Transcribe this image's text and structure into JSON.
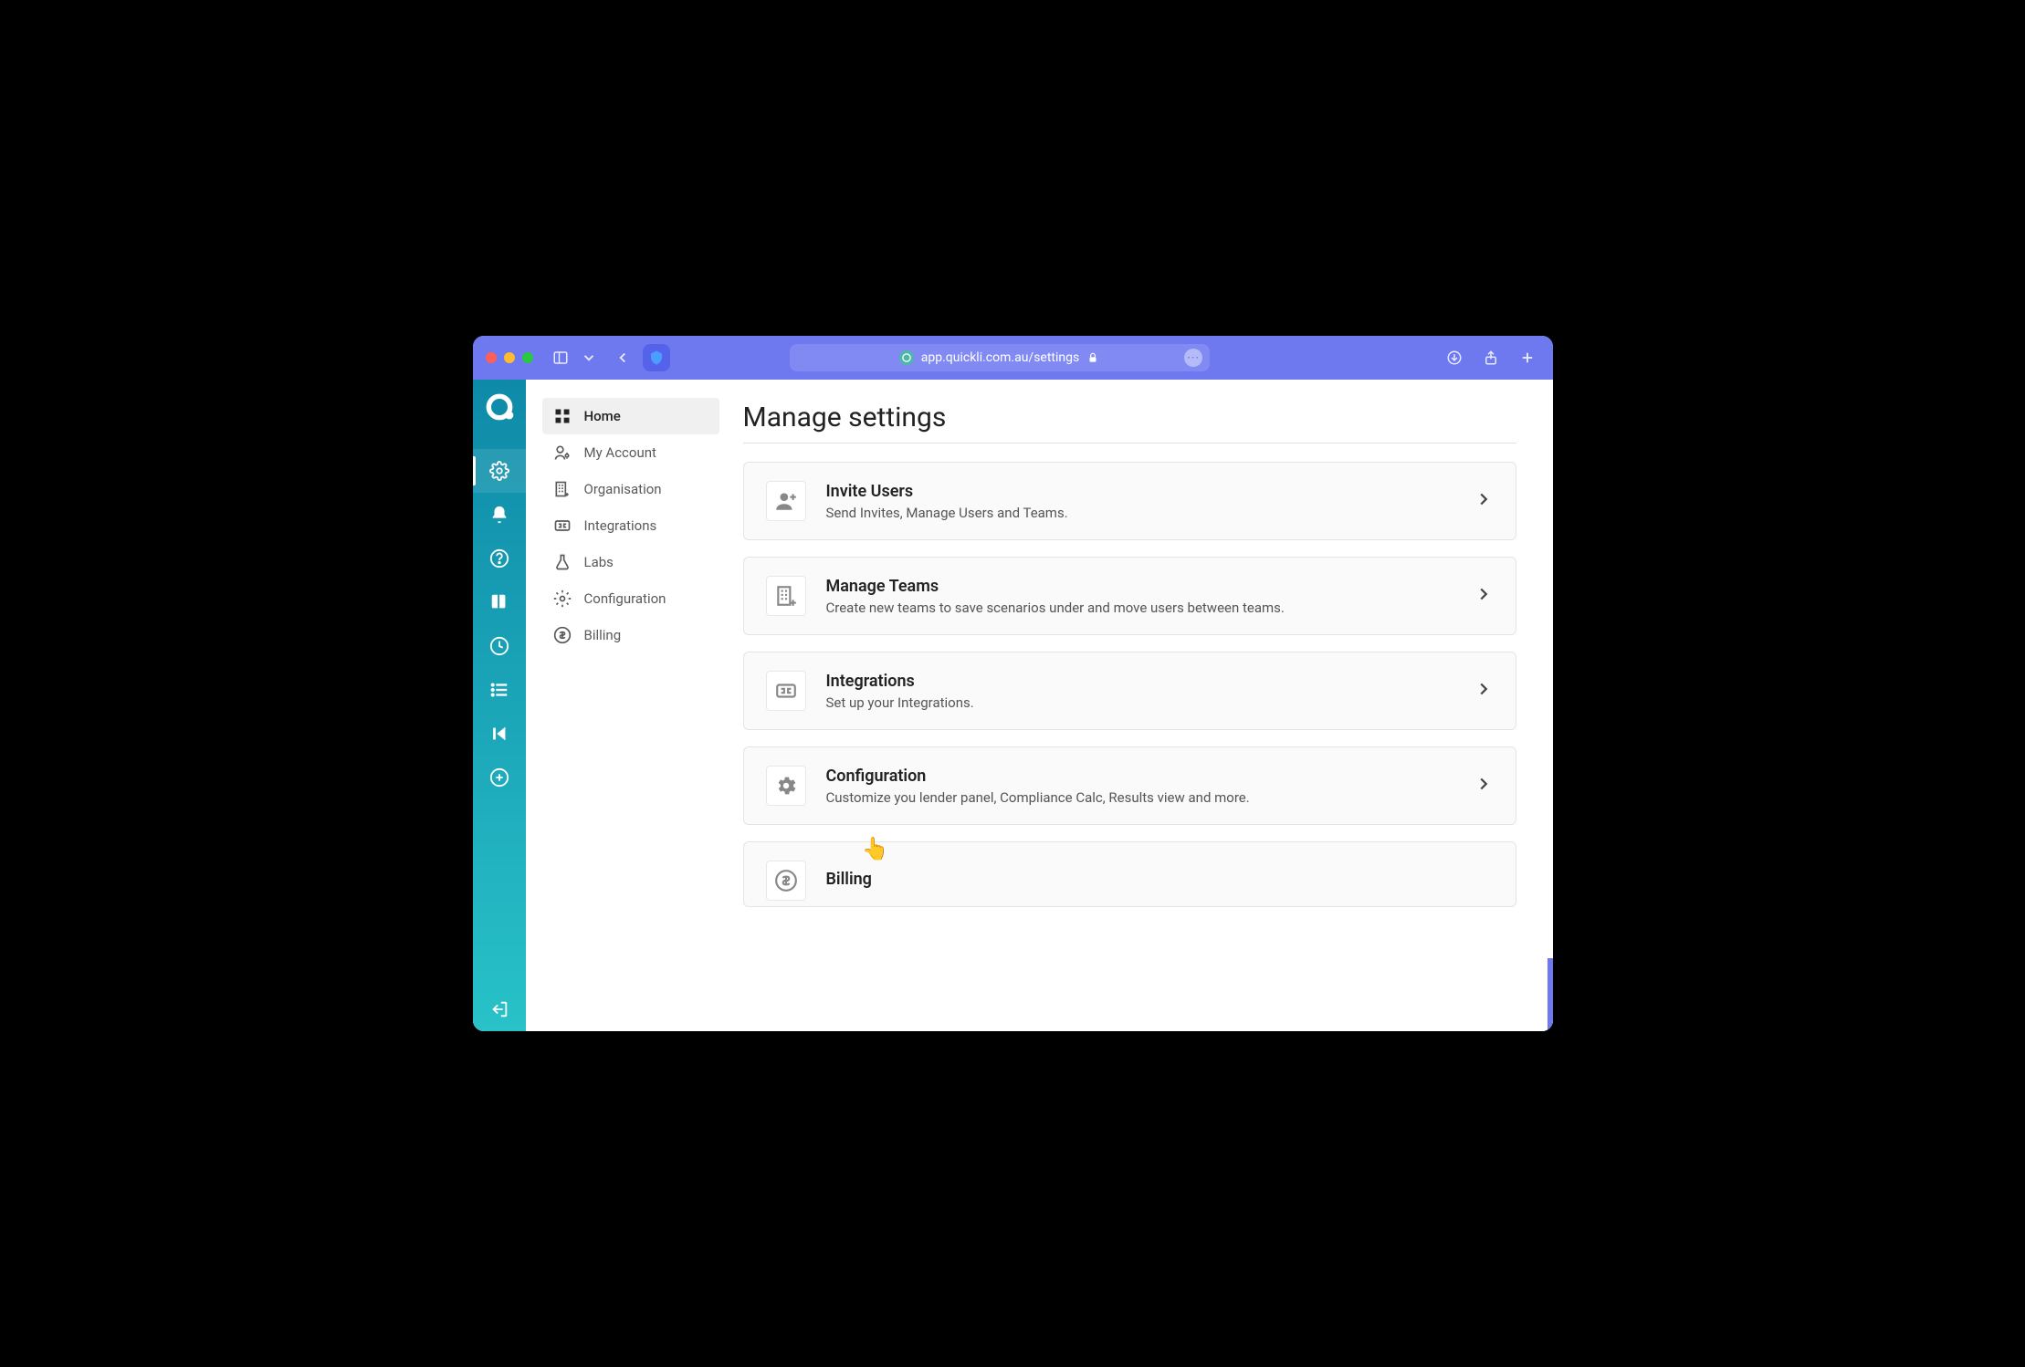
{
  "browser": {
    "url": "app.quickli.com.au/settings"
  },
  "leftnav": {
    "items": [
      {
        "name": "settings",
        "active": true
      },
      {
        "name": "notifications"
      },
      {
        "name": "help"
      },
      {
        "name": "book"
      },
      {
        "name": "history"
      },
      {
        "name": "list"
      },
      {
        "name": "skip-back"
      },
      {
        "name": "add"
      }
    ]
  },
  "subnav": {
    "items": [
      {
        "label": "Home",
        "icon": "dashboard",
        "active": true
      },
      {
        "label": "My Account",
        "icon": "person-gear"
      },
      {
        "label": "Organisation",
        "icon": "building"
      },
      {
        "label": "Integrations",
        "icon": "integrations"
      },
      {
        "label": "Labs",
        "icon": "flask"
      },
      {
        "label": "Configuration",
        "icon": "gear"
      },
      {
        "label": "Billing",
        "icon": "dollar"
      }
    ]
  },
  "page": {
    "title": "Manage settings",
    "cards": [
      {
        "title": "Invite Users",
        "desc": "Send Invites, Manage Users and Teams.",
        "icon": "invite"
      },
      {
        "title": "Manage Teams",
        "desc": "Create new teams to save scenarios under and move users between teams.",
        "icon": "teams"
      },
      {
        "title": "Integrations",
        "desc": "Set up your Integrations.",
        "icon": "integrations"
      },
      {
        "title": "Configuration",
        "desc": "Customize you lender panel, Compliance Calc, Results view and more.",
        "icon": "gear"
      },
      {
        "title": "Billing",
        "desc": "",
        "icon": "dollar"
      }
    ]
  },
  "cursor_emoji": "👆"
}
